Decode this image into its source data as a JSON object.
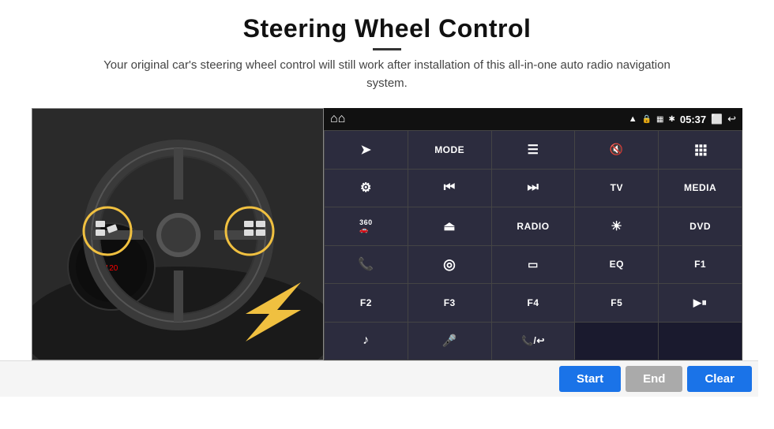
{
  "header": {
    "title": "Steering Wheel Control",
    "subtitle": "Your original car's steering wheel control will still work after installation of this all-in-one auto radio navigation system."
  },
  "status_bar": {
    "time": "05:37",
    "icons": [
      "wifi",
      "lock",
      "sim",
      "bluetooth",
      "screen",
      "back"
    ]
  },
  "button_grid": [
    {
      "id": "r1c1",
      "type": "icon",
      "icon": "navigate",
      "label": "▷"
    },
    {
      "id": "r1c2",
      "type": "text",
      "label": "MODE"
    },
    {
      "id": "r1c3",
      "type": "icon",
      "icon": "list",
      "label": "≡"
    },
    {
      "id": "r1c4",
      "type": "icon",
      "icon": "mute",
      "label": "🔇"
    },
    {
      "id": "r1c5",
      "type": "icon",
      "icon": "apps",
      "label": "⊞"
    },
    {
      "id": "r2c1",
      "type": "icon",
      "icon": "settings",
      "label": "⚙"
    },
    {
      "id": "r2c2",
      "type": "icon",
      "icon": "prev",
      "label": "⏮"
    },
    {
      "id": "r2c3",
      "type": "icon",
      "icon": "next",
      "label": "⏭"
    },
    {
      "id": "r2c4",
      "type": "text",
      "label": "TV"
    },
    {
      "id": "r2c5",
      "type": "text",
      "label": "MEDIA"
    },
    {
      "id": "r3c1",
      "type": "icon",
      "icon": "360cam",
      "label": "360"
    },
    {
      "id": "r3c2",
      "type": "icon",
      "icon": "eject",
      "label": "⏏"
    },
    {
      "id": "r3c3",
      "type": "text",
      "label": "RADIO"
    },
    {
      "id": "r3c4",
      "type": "icon",
      "icon": "brightness",
      "label": "☀"
    },
    {
      "id": "r3c5",
      "type": "text",
      "label": "DVD"
    },
    {
      "id": "r4c1",
      "type": "icon",
      "icon": "phone",
      "label": "📞"
    },
    {
      "id": "r4c2",
      "type": "icon",
      "icon": "maps",
      "label": "◎"
    },
    {
      "id": "r4c3",
      "type": "icon",
      "icon": "aspect",
      "label": "▭"
    },
    {
      "id": "r4c4",
      "type": "text",
      "label": "EQ"
    },
    {
      "id": "r4c5",
      "type": "text",
      "label": "F1"
    },
    {
      "id": "r5c1",
      "type": "text",
      "label": "F2"
    },
    {
      "id": "r5c2",
      "type": "text",
      "label": "F3"
    },
    {
      "id": "r5c3",
      "type": "text",
      "label": "F4"
    },
    {
      "id": "r5c4",
      "type": "text",
      "label": "F5"
    },
    {
      "id": "r5c5",
      "type": "icon",
      "icon": "playpause",
      "label": "▶⏸"
    },
    {
      "id": "r6c1",
      "type": "icon",
      "icon": "music",
      "label": "♪"
    },
    {
      "id": "r6c2",
      "type": "icon",
      "icon": "mic",
      "label": "🎤"
    },
    {
      "id": "r6c3",
      "type": "icon",
      "icon": "phonecall",
      "label": "📞/↩"
    },
    {
      "id": "r6c4",
      "type": "empty",
      "label": ""
    },
    {
      "id": "r6c5",
      "type": "empty",
      "label": ""
    }
  ],
  "action_bar": {
    "start_label": "Start",
    "end_label": "End",
    "clear_label": "Clear"
  }
}
